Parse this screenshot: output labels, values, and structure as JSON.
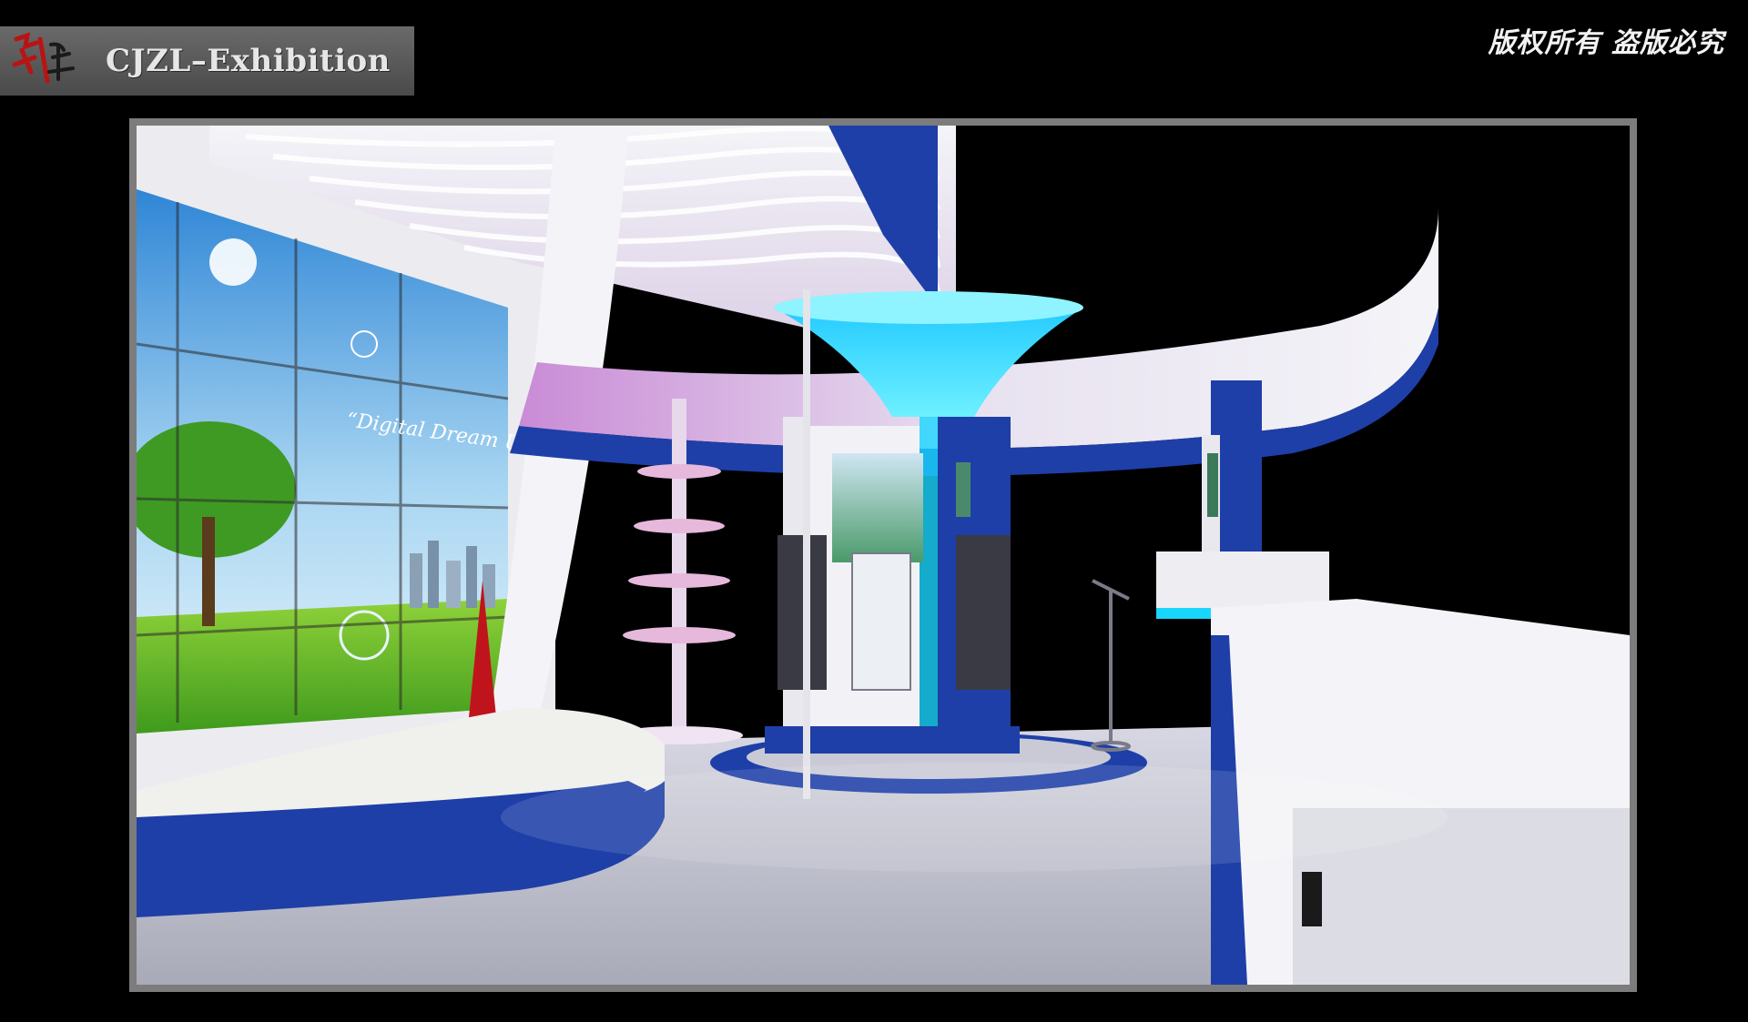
{
  "header": {
    "logo_text": "CJZL–Exhibition",
    "copyright": "版权所有  盗版必究"
  },
  "scene": {
    "video_wall_caption": "“Digital Dream Utopia”",
    "colors": {
      "booth_blue": "#1e3fa8",
      "booth_white": "#e8e8ee",
      "glow_cyan": "#19d6ff",
      "floor": "#c9cad6",
      "accent_red": "#c0141c"
    }
  }
}
